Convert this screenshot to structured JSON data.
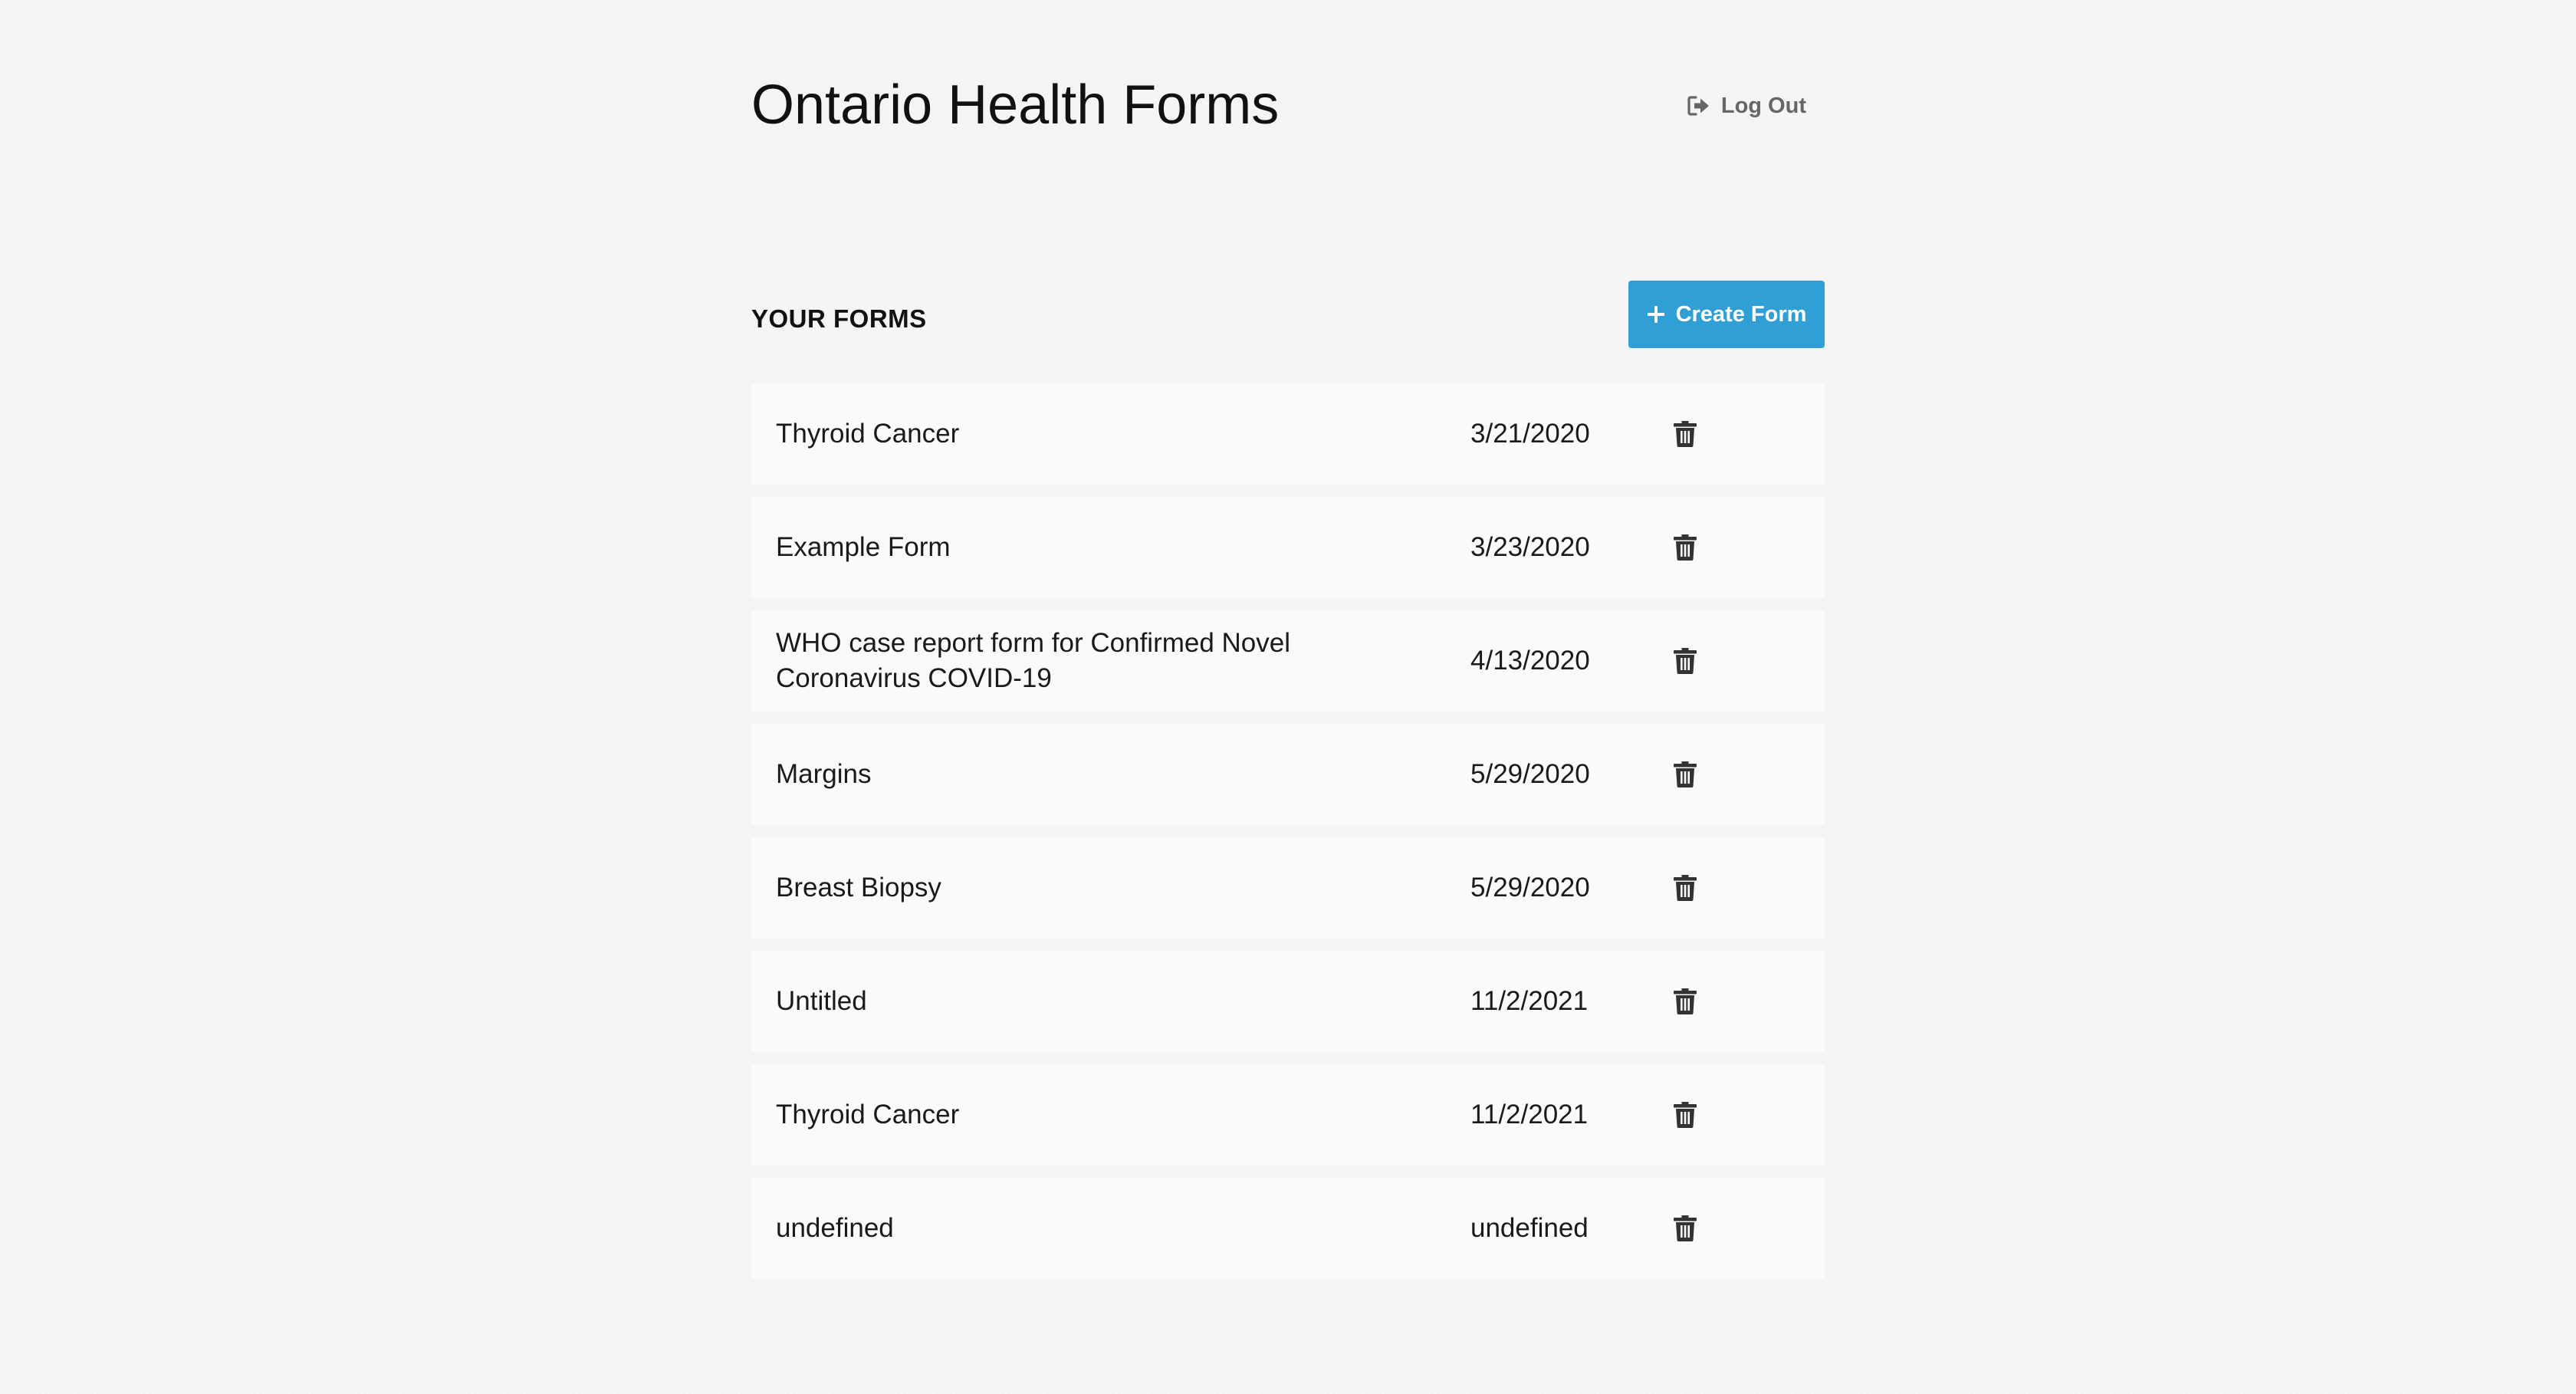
{
  "header": {
    "title": "Ontario Health Forms",
    "logout_label": "Log Out",
    "logout_icon": "sign-out-icon"
  },
  "forms_section": {
    "title": "YOUR FORMS",
    "create_label": "Create Form",
    "create_icon": "plus-icon",
    "accent_color": "#2f9fd6",
    "delete_icon": "trash-icon",
    "rows": [
      {
        "name": "Thyroid Cancer",
        "date": "3/21/2020"
      },
      {
        "name": "Example Form",
        "date": "3/23/2020"
      },
      {
        "name": "WHO case report form for Confirmed Novel Coronavirus COVID-19",
        "date": "4/13/2020"
      },
      {
        "name": "Margins",
        "date": "5/29/2020"
      },
      {
        "name": "Breast Biopsy",
        "date": "5/29/2020"
      },
      {
        "name": "Untitled",
        "date": "11/2/2021"
      },
      {
        "name": "Thyroid Cancer",
        "date": "11/2/2021"
      },
      {
        "name": "undefined",
        "date": "undefined"
      }
    ]
  }
}
